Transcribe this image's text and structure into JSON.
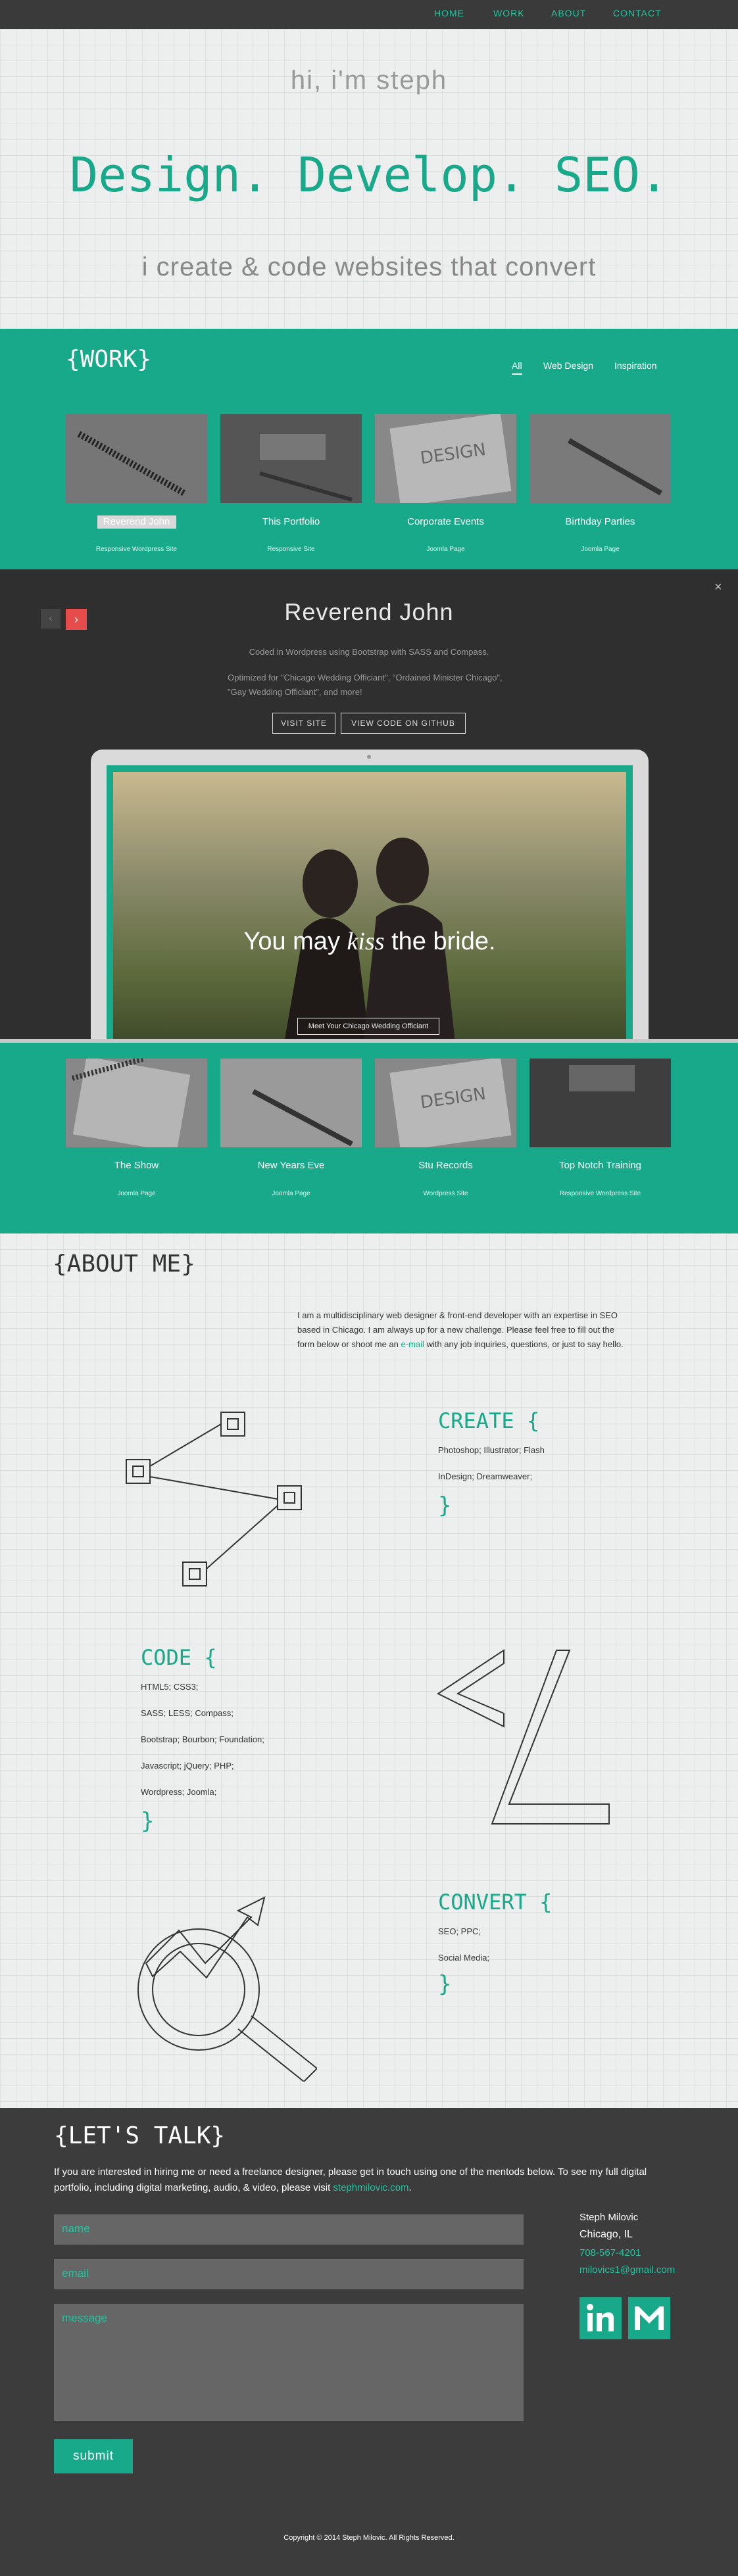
{
  "nav": {
    "links": [
      "HOME",
      "WORK",
      "ABOUT",
      "CONTACT"
    ]
  },
  "hero": {
    "greeting": "hi, i'm steph",
    "headline": "Design. Develop. SEO.",
    "tagline": "i create & code websites that convert"
  },
  "work": {
    "title": "{WORK}",
    "filters": [
      "All",
      "Web Design",
      "Inspiration"
    ],
    "items": [
      {
        "title": "Reverend John",
        "sub": "Responsive Wordpress Site"
      },
      {
        "title": "This Portfolio",
        "sub": "Responsive Site"
      },
      {
        "title": "Corporate Events",
        "sub": "Joomla Page"
      },
      {
        "title": "Birthday Parties",
        "sub": "Joomla Page"
      }
    ]
  },
  "overlay": {
    "title": "Reverend John",
    "desc1": "Coded in Wordpress using Bootstrap with SASS and Compass.",
    "desc2": "Optimized for \"Chicago Wedding Officiant\", \"Ordained Minister Chicago\", \"Gay Wedding Officiant\", and more!",
    "visit": "VISIT SITE",
    "github": "VIEW CODE ON GITHUB",
    "screen_headline_a": "You may",
    "screen_headline_b": "kiss",
    "screen_headline_c": "the bride.",
    "screen_button": "Meet Your Chicago Wedding Officiant"
  },
  "work2": {
    "items": [
      {
        "title": "The Show",
        "sub": "Joomla Page"
      },
      {
        "title": "New Years Eve",
        "sub": "Joomla Page"
      },
      {
        "title": "Stu Records",
        "sub": "Wordpress Site"
      },
      {
        "title": "Top Notch Training",
        "sub": "Responsive Wordpress Site"
      }
    ]
  },
  "about": {
    "title": "{ABOUT ME}",
    "intro_a": "I am a multidisciplinary web designer & front-end developer with an expertise in SEO based in Chicago. I am always up for a new challenge. Please feel free to fill out the form below or shoot me an",
    "intro_link": "e-mail",
    "intro_b": "with any job inquiries, questions, or just to say hello.",
    "create": {
      "title": "CREATE {",
      "lines": [
        "Photoshop; Illustrator; Flash",
        "InDesign; Dreamweaver;"
      ]
    },
    "code": {
      "title": "CODE {",
      "lines": [
        "HTML5; CSS3;",
        "SASS; LESS; Compass;",
        "Bootstrap; Bourbon; Foundation;",
        "Javascript; jQuery; PHP;",
        "Wordpress; Joomla;"
      ]
    },
    "convert": {
      "title": "CONVERT {",
      "lines": [
        "SEO; PPC;",
        "Social Media;"
      ]
    },
    "close": "}"
  },
  "contact": {
    "title": "{LET'S TALK}",
    "text_a": "If you are interested in hiring me or need a freelance designer, please get in touch using one of the mentods below. To see my full digital portfolio, including digital marketing, audio, & video, please visit",
    "text_link": "stephmilovic.com",
    "name_ph": "name",
    "email_ph": "email",
    "message_ph": "message",
    "submit": "submit",
    "info_name": "Steph Milovic",
    "info_city": "Chicago, IL",
    "info_phone": "708-567-4201",
    "info_email": "milovics1@gmail.com",
    "copyright": "Copyright © 2014 Steph Milovic. All Rights Reserved."
  },
  "colors": {
    "accent": "#17a98a",
    "accent_light": "#1fc5a0",
    "dark": "#3c3c3c",
    "red": "#e74c4c"
  },
  "icons": [
    "close-icon",
    "chevron-left-icon",
    "chevron-right-icon",
    "linkedin-icon",
    "gmail-icon"
  ]
}
